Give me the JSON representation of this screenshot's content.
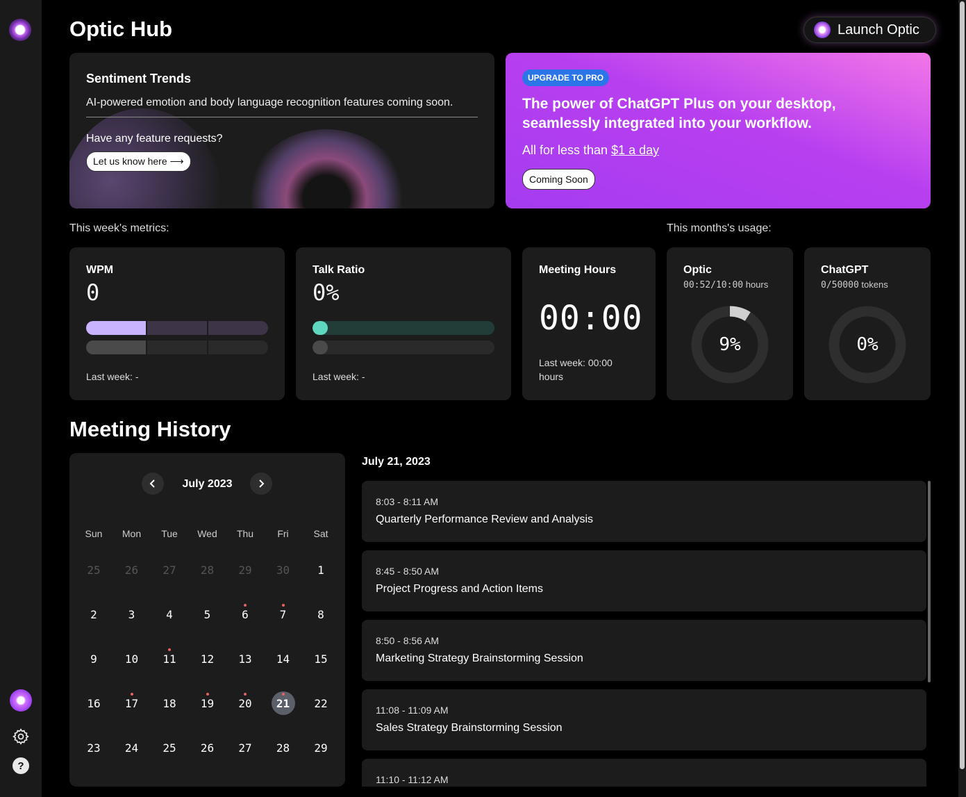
{
  "app": {
    "title": "Optic Hub",
    "launch_label": "Launch Optic"
  },
  "sidebar": {
    "logo_icon": "optic-logo-icon",
    "avatar_icon": "optic-avatar-icon",
    "settings_icon": "gear-icon",
    "help_icon": "help-icon",
    "help_glyph": "?"
  },
  "sentiment": {
    "title": "Sentiment Trends",
    "description": "AI-powered emotion and body language recognition features coming soon.",
    "question": "Have any feature requests?",
    "link_label": "Let us know here ⟶"
  },
  "upgrade": {
    "badge": "UPGRADE TO PRO",
    "headline": "The power of ChatGPT Plus on your desktop, seamlessly integrated into your workflow.",
    "sub_prefix": "All for less than ",
    "sub_link": "$1 a day",
    "button_label": "Coming Soon",
    "gradient_from": "#a53cf0",
    "gradient_to": "#f277e8"
  },
  "metrics": {
    "week_label": "This week's metrics:",
    "month_label": "This months's usage:",
    "wpm": {
      "title": "WPM",
      "value": "0",
      "last_week": "Last week: -",
      "current_fill": 0.33,
      "accent": "#c9b3ff"
    },
    "talk_ratio": {
      "title": "Talk Ratio",
      "value": "0%",
      "last_week": "Last week: -",
      "accent": "#5fd6c0"
    },
    "meeting_hours": {
      "title": "Meeting Hours",
      "value": "00:00",
      "last_week": "Last week: 00:00 hours"
    },
    "optic_usage": {
      "title": "Optic",
      "used": "00:52/10:00",
      "unit": "hours",
      "percent_label": "9%",
      "percent": 0.09
    },
    "chatgpt_usage": {
      "title": "ChatGPT",
      "used": "0/50000",
      "unit": "tokens",
      "percent_label": "0%",
      "percent": 0
    }
  },
  "history": {
    "title": "Meeting History",
    "calendar": {
      "month": "July 2023",
      "weekdays": [
        "Sun",
        "Mon",
        "Tue",
        "Wed",
        "Thu",
        "Fri",
        "Sat"
      ],
      "weeks": [
        [
          {
            "d": "25",
            "muted": true
          },
          {
            "d": "26",
            "muted": true
          },
          {
            "d": "27",
            "muted": true
          },
          {
            "d": "28",
            "muted": true
          },
          {
            "d": "29",
            "muted": true
          },
          {
            "d": "30",
            "muted": true
          },
          {
            "d": "1"
          }
        ],
        [
          {
            "d": "2"
          },
          {
            "d": "3"
          },
          {
            "d": "4"
          },
          {
            "d": "5"
          },
          {
            "d": "6",
            "dot": true
          },
          {
            "d": "7",
            "dot": true
          },
          {
            "d": "8"
          }
        ],
        [
          {
            "d": "9"
          },
          {
            "d": "10"
          },
          {
            "d": "11",
            "dot": true
          },
          {
            "d": "12"
          },
          {
            "d": "13"
          },
          {
            "d": "14"
          },
          {
            "d": "15"
          }
        ],
        [
          {
            "d": "16"
          },
          {
            "d": "17",
            "dot": true
          },
          {
            "d": "18"
          },
          {
            "d": "19",
            "dot": true
          },
          {
            "d": "20",
            "dot": true
          },
          {
            "d": "21",
            "dot": true,
            "selected": true
          },
          {
            "d": "22"
          }
        ],
        [
          {
            "d": "23"
          },
          {
            "d": "24"
          },
          {
            "d": "25"
          },
          {
            "d": "26"
          },
          {
            "d": "27"
          },
          {
            "d": "28"
          },
          {
            "d": "29"
          }
        ]
      ]
    },
    "selected_date": "July 21, 2023",
    "meetings": [
      {
        "time": "8:03 - 8:11 AM",
        "title": "Quarterly Performance Review and Analysis"
      },
      {
        "time": "8:45 - 8:50 AM",
        "title": "Project Progress and Action Items"
      },
      {
        "time": "8:50 - 8:56 AM",
        "title": "Marketing Strategy Brainstorming Session"
      },
      {
        "time": "11:08 - 11:09 AM",
        "title": "Sales Strategy Brainstorming Session"
      },
      {
        "time": "11:10 - 11:12 AM",
        "title": ""
      }
    ]
  }
}
